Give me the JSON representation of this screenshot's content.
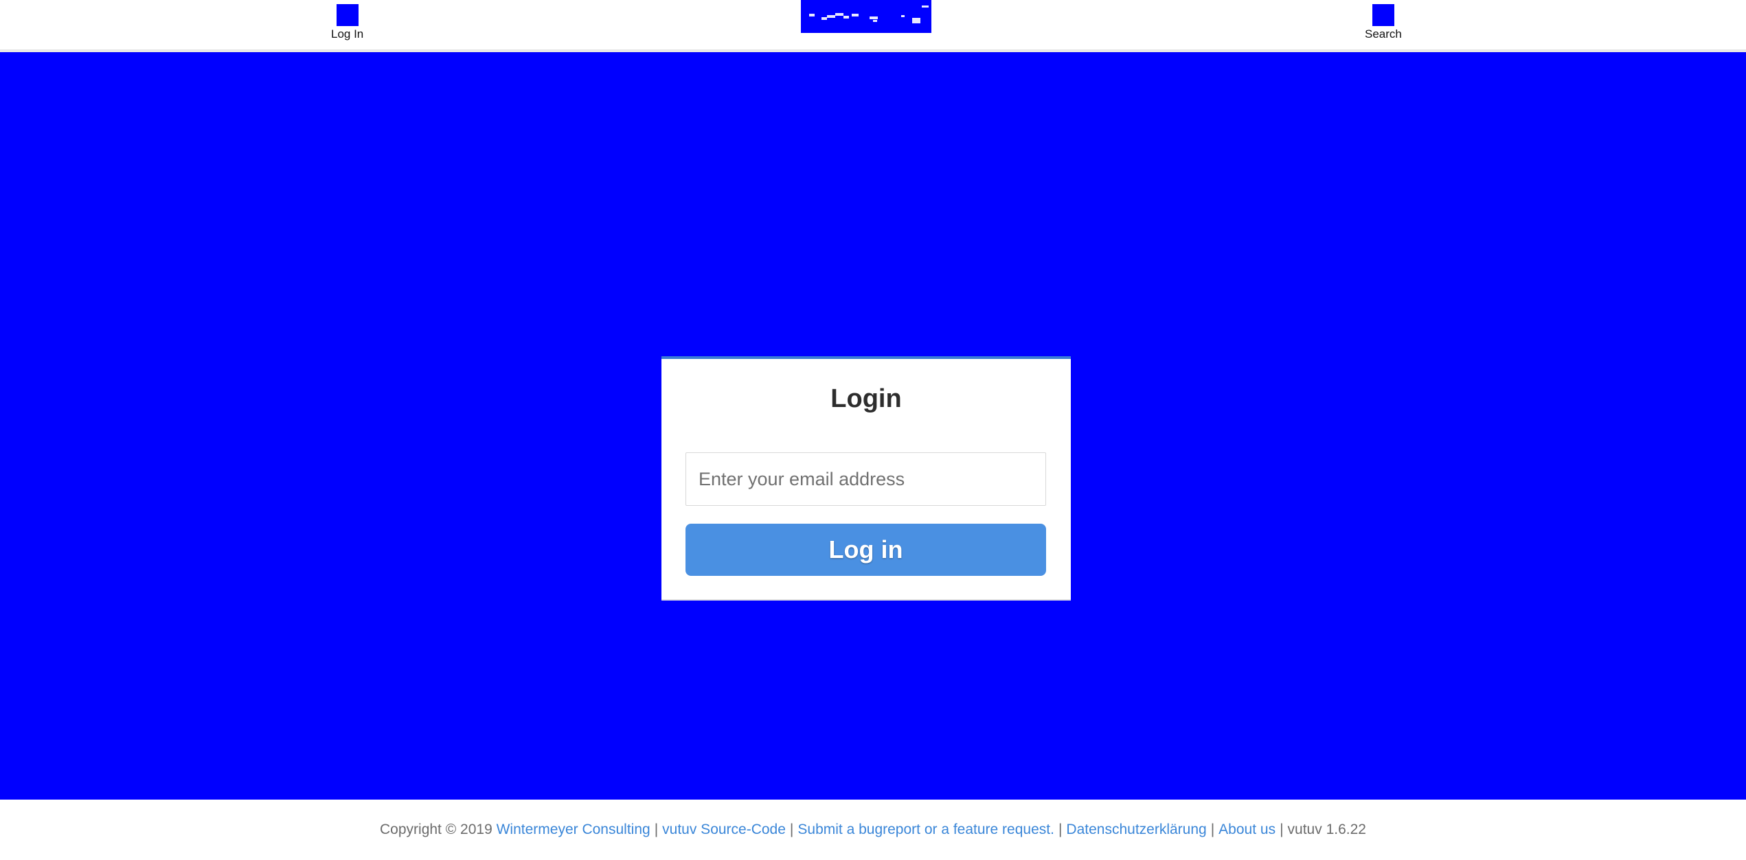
{
  "header": {
    "login_label": "Log In",
    "search_label": "Search",
    "login_icon": "user-icon",
    "search_icon": "search-icon",
    "logo_icon": "vutuv-logo"
  },
  "login": {
    "title": "Login",
    "email_placeholder": "Enter your email address",
    "email_value": "",
    "button_label": "Log in"
  },
  "footer": {
    "copyright": "Copyright © 2019",
    "company_link": "Wintermeyer Consulting",
    "source_link": "vutuv Source-Code",
    "bugreport_link": "Submit a bugreport or a feature request.",
    "privacy_link": "Datenschutzerklärung",
    "about_link": "About us",
    "version": "vutuv 1.6.22",
    "separator": "|"
  },
  "colors": {
    "background": "#0000ff",
    "button": "#4a90e2",
    "link": "#3a86d8",
    "footer_text": "#6b6b6b"
  }
}
